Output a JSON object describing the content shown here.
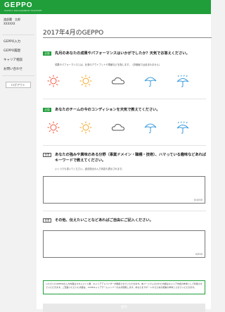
{
  "header": {
    "logo": "GEPPO",
    "logo_sub": "SUPPLY ENGAGEMENT SUPPORT"
  },
  "sidebar": {
    "user_name": "渡部翼　太郎",
    "user_id": "XXXXXX",
    "items": [
      {
        "label": "GEPPO入力"
      },
      {
        "label": "GEPPO履歴"
      },
      {
        "label": "キャリア相談"
      },
      {
        "label": "お問い合わせ"
      }
    ],
    "logout_label": "ログアウト"
  },
  "main": {
    "title": "2017年4月のGEPPO",
    "q1": {
      "tag": "必須",
      "text": "先月のあなたの成果やパフォーマンスはいかがでしたか？天気でお答えください。",
      "note": "成果やパフォーマンスとは、仕事のアウトプットや業績などを指します。（評価面では含まれません）",
      "icons": [
        "sunny-icon",
        "partly-sunny-icon",
        "cloudy-icon",
        "umbrella-icon",
        "rainy-umbrella-icon"
      ]
    },
    "q2": {
      "tag": "必須",
      "text": "あなたのチームの今のコンディションを天気で教えてください。",
      "icons": [
        "sunny-icon",
        "partly-sunny-icon",
        "cloudy-icon",
        "umbrella-icon",
        "rainy-umbrella-icon"
      ]
    },
    "q3": {
      "tag": "任意",
      "text": "あなたの強みや興味のある分野（事業ドメイン・職種・技術）、ハマっている趣味などあればキーワードで教えてください。",
      "note": "いくつでも書いてください。過去提出の入力内容も表示されます。",
      "counter": "0/1000"
    },
    "q4": {
      "tag": "任意",
      "text": "その他、伝えたいことなどあればご自由にご記入ください。",
      "counter": "0/500"
    },
    "notice": "いただいたGEPPOの入力内容はマネジメント層、キャリアアドバイザーが確認させていただきます。本ページで入力された内容はキャリア支援の参考として利用させていただきます。ご回答いただいた内容は、CASEキャリアチームメンバーのみが閲覧します。あなたをサポートするための施策の参考とさせていただきます。",
    "submit_label": "送信"
  },
  "colors": {
    "brand": "#1f9e3a",
    "sun": "#f5533d",
    "sun_partial": "#f6a623",
    "cloud": "#555555",
    "umbrella": "#3b9bdc"
  }
}
